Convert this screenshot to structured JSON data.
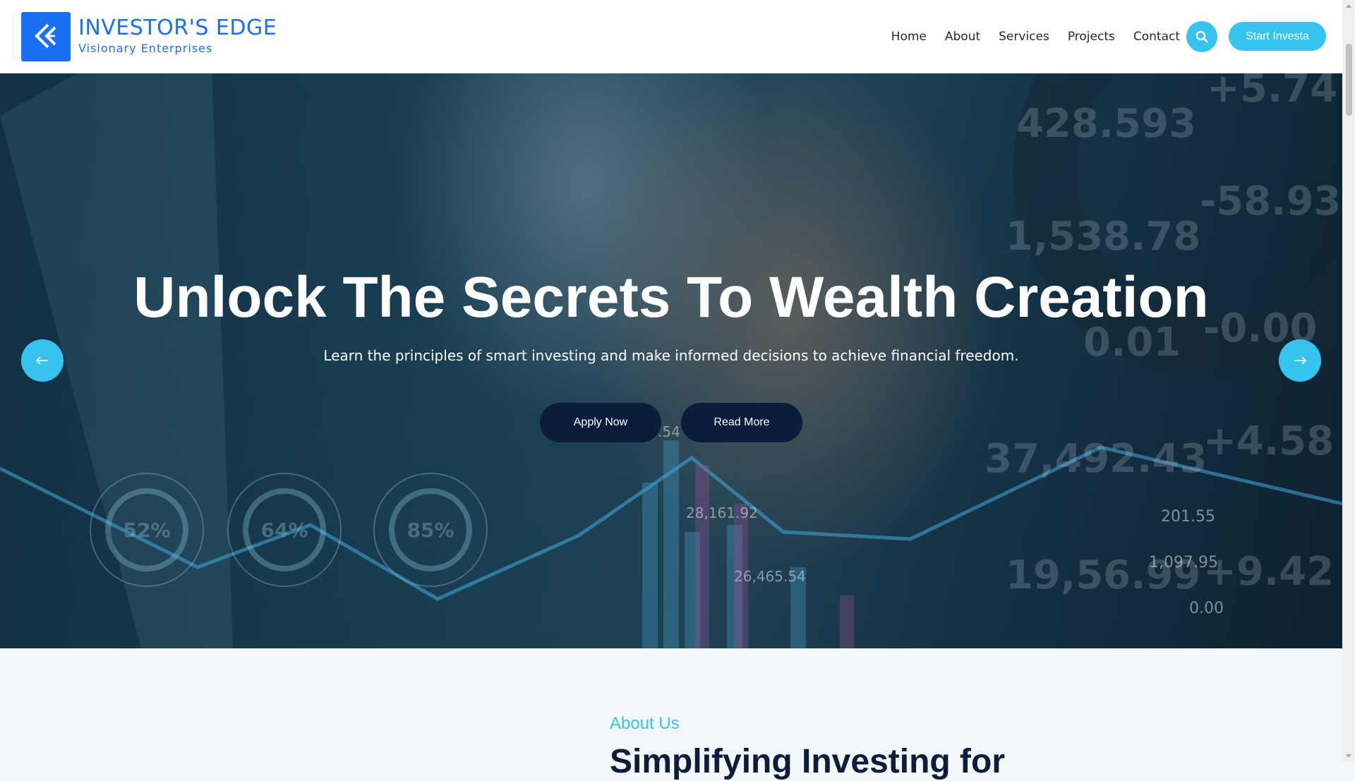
{
  "brand": {
    "name": "INVESTOR'S EDGE",
    "tagline": "Visionary Enterprises",
    "logo_icon": "chevron-logo-icon",
    "color": "#1a6ff5"
  },
  "nav": {
    "items": [
      {
        "label": "Home"
      },
      {
        "label": "About"
      },
      {
        "label": "Services"
      },
      {
        "label": "Projects"
      },
      {
        "label": "Contact"
      }
    ],
    "search_icon": "search-icon",
    "cta_label": "Start Investa",
    "accent": "#36c3f0"
  },
  "hero": {
    "title": "Unlock The Secrets To Wealth Creation",
    "subtitle": "Learn the principles of smart investing and make informed decisions to achieve financial freedom.",
    "buttons": [
      {
        "label": "Apply Now"
      },
      {
        "label": "Read More"
      }
    ],
    "prev_icon": "arrow-left-icon",
    "next_icon": "arrow-right-icon",
    "button_color": "#0c1d3b",
    "background_numbers": [
      "428.593",
      "+5.74",
      "1,538.78",
      "-58.93",
      "0.01",
      "-0.00",
      "37,492.43",
      "+4.58",
      "28,161.92",
      "26,465.54",
      "201.55",
      "1,097.95",
      "19,56.99",
      "+9.42",
      "0.00",
      "52%",
      "64%",
      "85%",
      ".54"
    ]
  },
  "about": {
    "label": "About Us",
    "heading": "Simplifying Investing for"
  }
}
